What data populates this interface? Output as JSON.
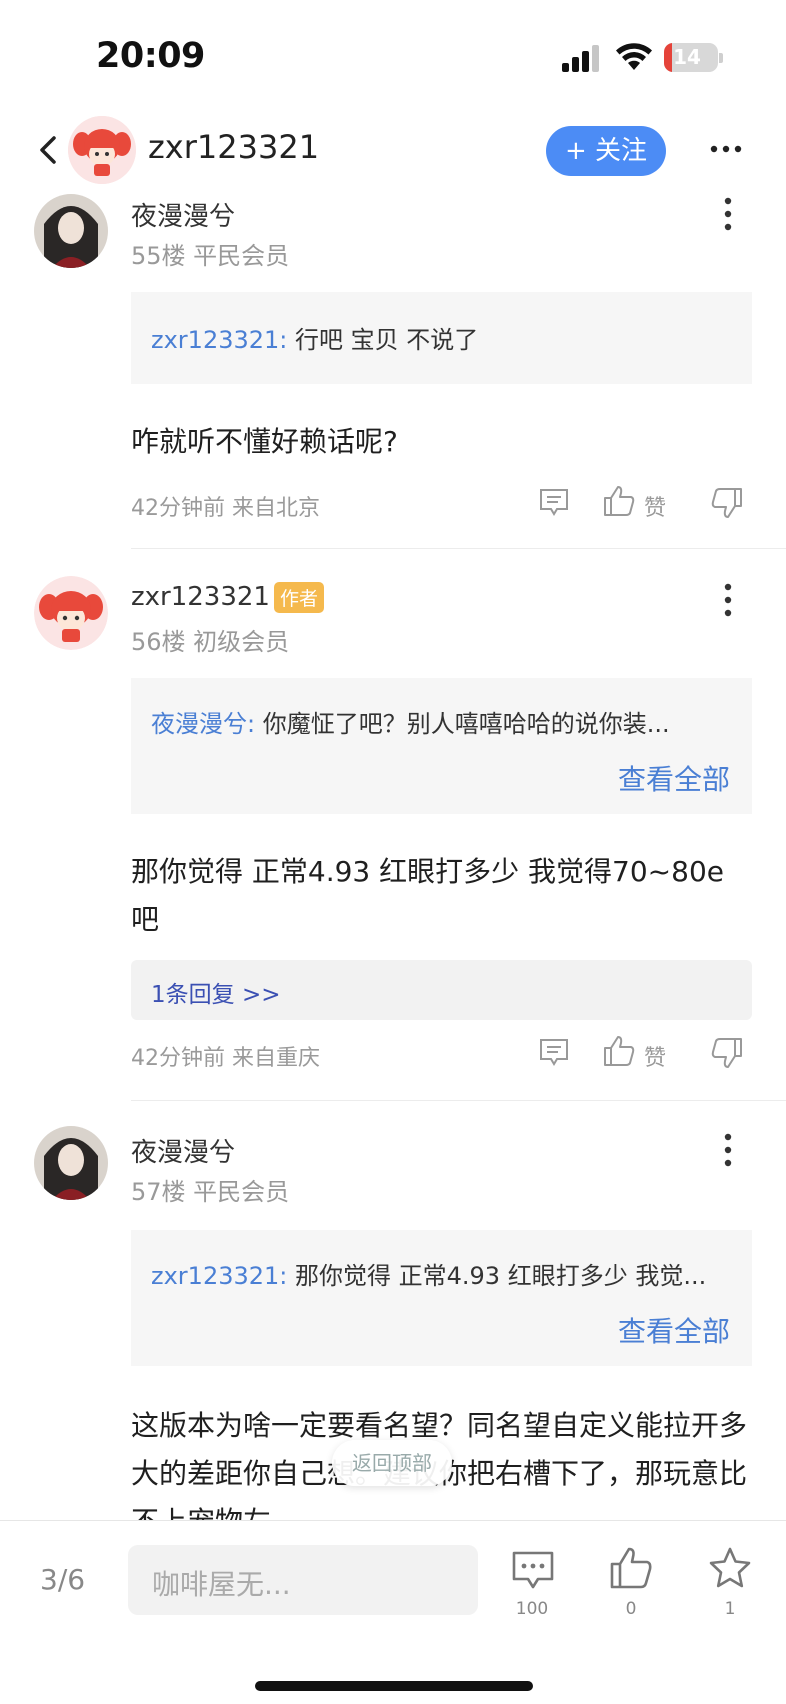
{
  "status_bar": {
    "time": "20:09",
    "battery": "14",
    "battery_level": 0.14,
    "battery_color": "#e5433a"
  },
  "header": {
    "name": "zxr123321",
    "follow_label": "+ 关注"
  },
  "posts": [
    {
      "name": "夜漫漫兮",
      "floor": "55楼 平民会员",
      "quote_user": "zxr123321:",
      "quote_text": " 行吧 宝贝 不说了",
      "body": "咋就听不懂好赖话呢?",
      "meta": "42分钟前 来自北京",
      "like_label": "赞"
    },
    {
      "name": "zxr123321",
      "author_tag": "作者",
      "floor": "56楼 初级会员",
      "quote_user": "夜漫漫兮:",
      "quote_text": " 你魔怔了吧？别人嘻嘻哈哈的说你装...",
      "see_all": "查看全部",
      "body": "那你觉得 正常4.93 红眼打多少 我觉得70~80e吧",
      "reply_count": "1条回复 >>",
      "meta": "42分钟前 来自重庆",
      "like_label": "赞"
    },
    {
      "name": "夜漫漫兮",
      "floor": "57楼 平民会员",
      "quote_user": "zxr123321:",
      "quote_text": " 那你觉得 正常4.93 红眼打多少 我觉...",
      "see_all": "查看全部",
      "body": "这版本为啥一定要看名望？同名望自定义能拉开多大的差距你自己想。建议你把右槽下了，那玩意比不上宠物左"
    }
  ],
  "back_to_top": "返回顶部",
  "bottom_bar": {
    "page": "3/6",
    "input_placeholder": "咖啡屋无...",
    "comment_count": "100",
    "like_count": "0",
    "fav_count": "1"
  },
  "colors": {
    "accent": "#4c8cf5",
    "link": "#4a7fd4",
    "author_tag": "#f5b94d"
  },
  "icons": [
    "back-icon",
    "more-icon",
    "comment-icon",
    "like-icon",
    "dislike-icon",
    "star-icon"
  ]
}
